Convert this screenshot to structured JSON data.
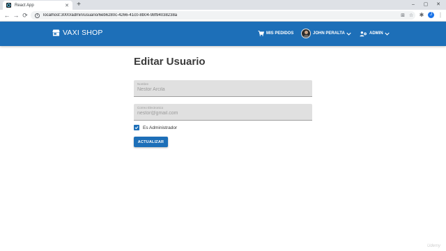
{
  "browser": {
    "tab_title": "React App",
    "tab_close": "✕",
    "new_tab": "+",
    "window_controls": [
      "–",
      "▢",
      "✕"
    ],
    "back": "←",
    "forward": "→",
    "reload": "⟳",
    "url": "localhost:3000/admin/usuario/6eb6280c-4266-41c0-8b04-98f94038238a",
    "profile_initial": "J"
  },
  "header": {
    "brand": "VAXI SHOP",
    "orders": "MIS PEDIDOS",
    "user": "JOHN PERALTA",
    "admin": "ADMIN",
    "accent_color": "#1d6fb8"
  },
  "form": {
    "title": "Editar Usuario",
    "name_label": "Nombre",
    "name_value": "Nestor Arcila",
    "email_label": "Correo Electronico",
    "email_value": "nestor@gmail.com",
    "is_admin_label": "Es Administrador",
    "is_admin_checked": true,
    "submit": "ACTUALIZAR"
  },
  "watermark": "Udemy"
}
